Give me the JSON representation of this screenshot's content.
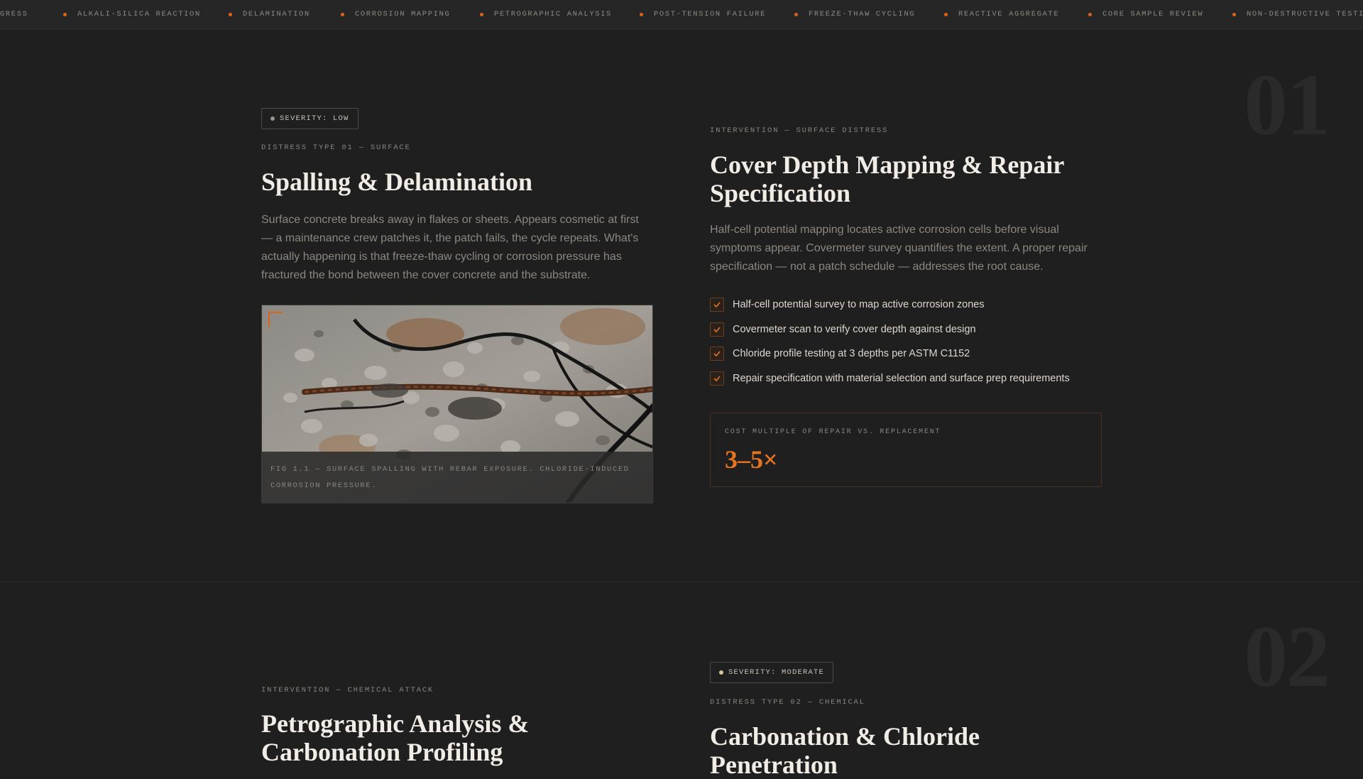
{
  "ticker": {
    "items": [
      "GRESS",
      "ALKALI-SILICA REACTION",
      "DELAMINATION",
      "CORROSION MAPPING",
      "PETROGRAPHIC ANALYSIS",
      "POST-TENSION FAILURE",
      "FREEZE-THAW CYCLING",
      "REACTIVE AGGREGATE",
      "CORE SAMPLE REVIEW",
      "NON-DESTRUCTIVE TESTIN"
    ],
    "accent": "#d9651f"
  },
  "sections": [
    {
      "number": "01",
      "left": {
        "severity": "SEVERITY: LOW",
        "eyebrow": "DISTRESS TYPE 01 — SURFACE",
        "title": "Spalling & Delamination",
        "body": "Surface concrete breaks away in flakes or sheets. Appears cosmetic at first — a maintenance crew patches it, the patch fails, the cycle repeats. What's actually happening is that freeze-thaw cycling or corrosion pressure has fractured the bond between the cover concrete and the substrate.",
        "figure": {
          "caption": "FIG 1.1 — SURFACE SPALLING WITH REBAR EXPOSURE. CHLORIDE-INDUCED CORROSION PRESSURE."
        }
      },
      "right": {
        "eyebrow": "INTERVENTION — SURFACE DISTRESS",
        "title": "Cover Depth Mapping & Repair Specification",
        "body": "Half-cell potential mapping locates active corrosion cells before visual symptoms appear. Covermeter survey quantifies the extent. A proper repair specification — not a patch schedule — addresses the root cause.",
        "checklist": [
          "Half-cell potential survey to map active corrosion zones",
          "Covermeter scan to verify cover depth against design",
          "Chloride profile testing at 3 depths per ASTM C1152",
          "Repair specification with material selection and surface prep requirements"
        ],
        "stat": {
          "label": "COST MULTIPLE OF REPAIR VS. REPLACEMENT",
          "value": "3–5×"
        }
      }
    },
    {
      "number": "02",
      "left": {
        "eyebrow": "INTERVENTION — CHEMICAL ATTACK",
        "title": "Petrographic Analysis & Carbonation Profiling"
      },
      "right": {
        "severity": "SEVERITY: MODERATE",
        "eyebrow": "DISTRESS TYPE 02 — CHEMICAL",
        "title": "Carbonation & Chloride Penetration"
      }
    }
  ]
}
